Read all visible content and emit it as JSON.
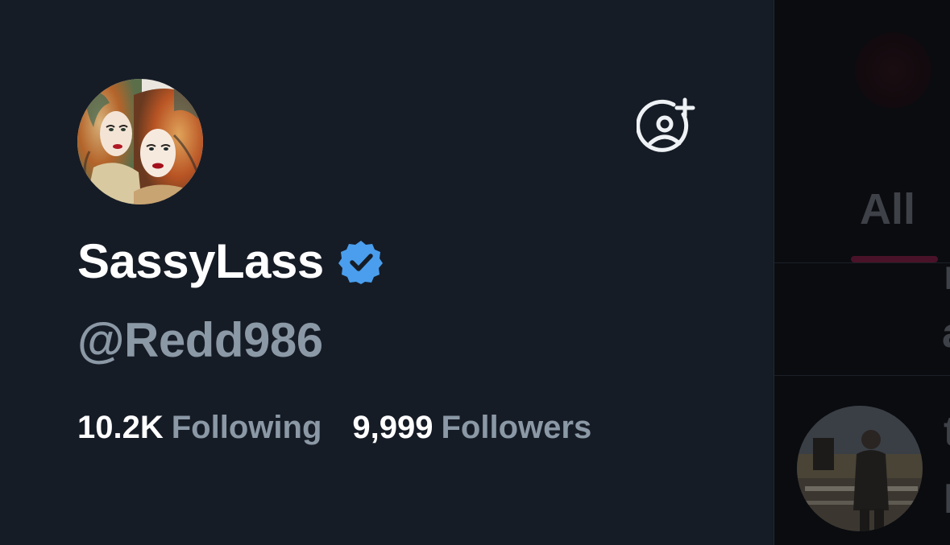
{
  "profile": {
    "display_name": "SassyLass",
    "handle": "@Redd986",
    "verified": true
  },
  "stats": {
    "following_value": "10.2K",
    "following_label": "Following",
    "followers_value": "9,999",
    "followers_label": "Followers"
  },
  "background": {
    "tab_label": "All",
    "fragment_1": "r",
    "fragment_2": "a",
    "fragment_3": "t",
    "fragment_4": "I"
  },
  "icons": {
    "add_account": "add-account-icon",
    "verified": "verified-badge-icon"
  },
  "colors": {
    "drawer_bg": "#161c26",
    "text_primary": "#ffffff",
    "text_secondary": "#8b98a5",
    "verified_blue": "#1d9bf0",
    "tab_indicator": "#4a1228"
  }
}
